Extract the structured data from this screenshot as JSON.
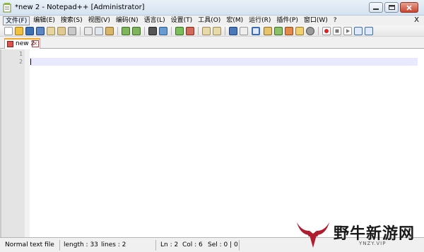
{
  "window": {
    "title": "*new 2 - Notepad++ [Administrator]"
  },
  "menubar": {
    "items": [
      "文件(F)",
      "编辑(E)",
      "搜索(S)",
      "视图(V)",
      "编码(N)",
      "语言(L)",
      "设置(T)",
      "工具(O)",
      "宏(M)",
      "运行(R)",
      "插件(P)",
      "窗口(W)",
      "?"
    ],
    "close_label": "X"
  },
  "tabs": [
    {
      "label": "new 2"
    }
  ],
  "editor": {
    "line_numbers": [
      "1",
      "2"
    ]
  },
  "statusbar": {
    "file_type": "Normal text file",
    "length": "length : 33",
    "lines": "lines : 2",
    "ln": "Ln : 2",
    "col": "Col : 6",
    "sel": "Sel : 0 | 0"
  },
  "watermark": {
    "text": "野牛新游网",
    "url": "YNZY.VIP"
  },
  "colors": {
    "current_line": "#e8e8ff",
    "tab_accent": "#f5a623",
    "gutter": "#e4e4e4"
  }
}
